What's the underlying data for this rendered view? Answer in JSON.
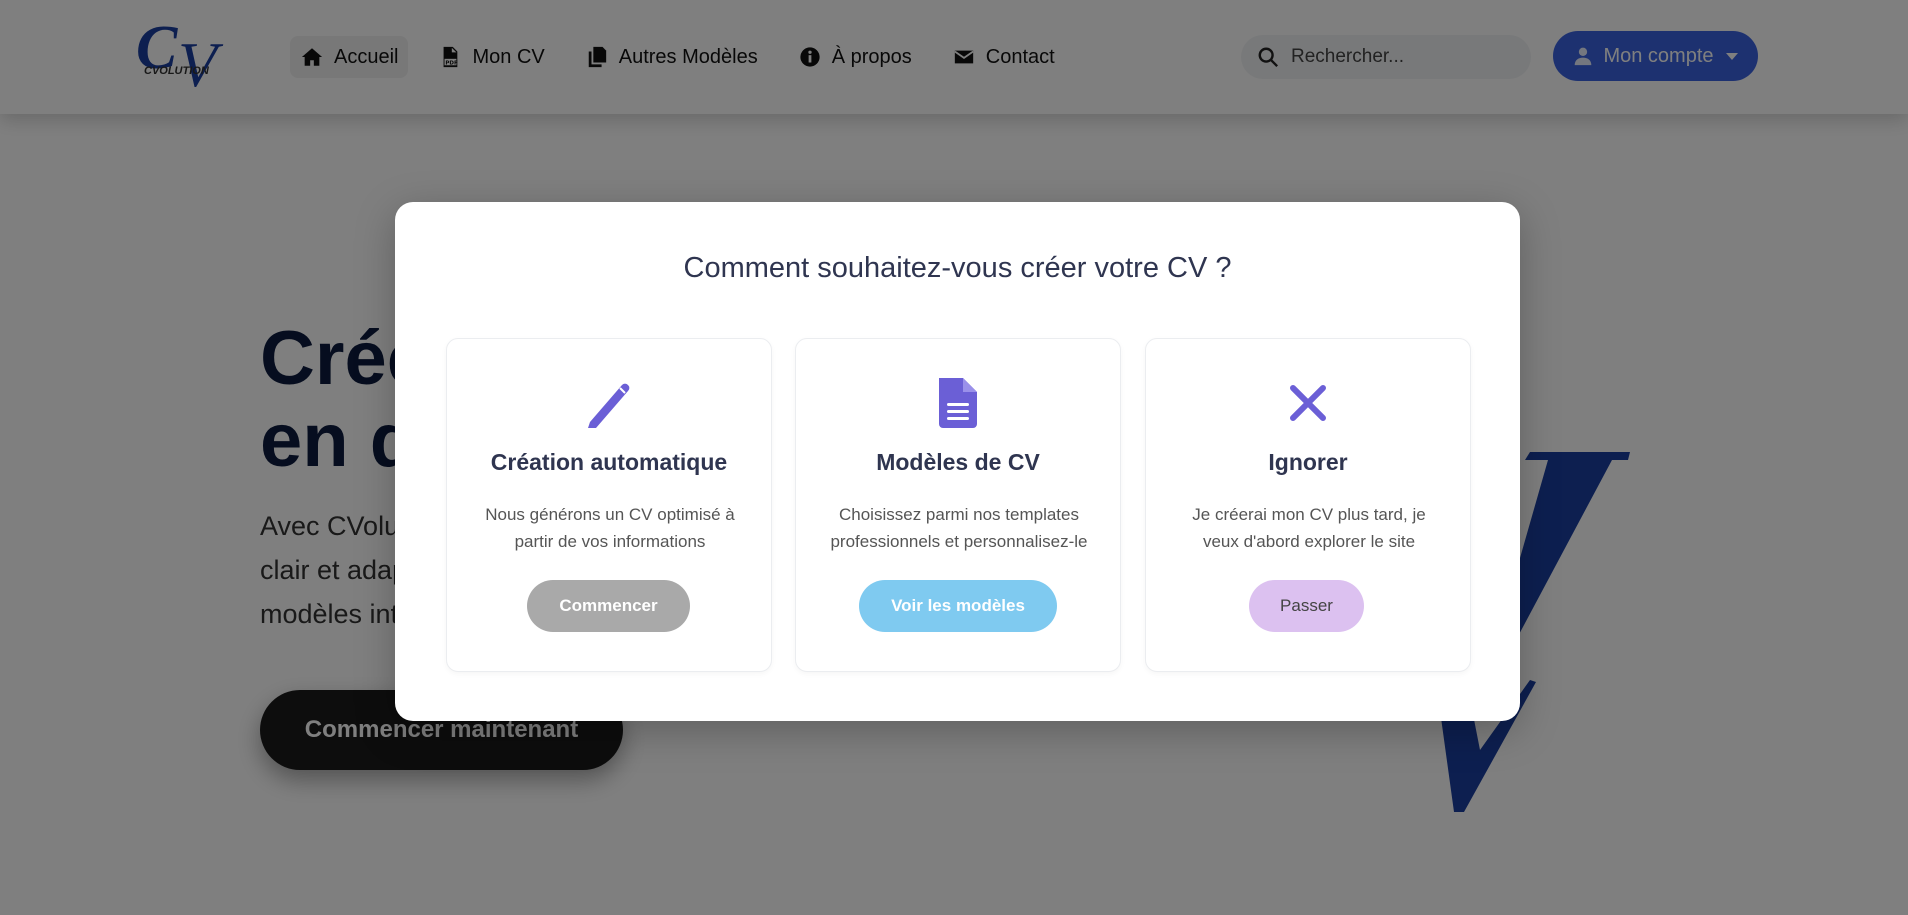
{
  "header": {
    "logo": {
      "alt": "CVolution logo",
      "text_main": "CV",
      "text_sub": "CVOLUTION"
    },
    "nav": [
      {
        "label": "Accueil",
        "icon": "home-icon",
        "active": true
      },
      {
        "label": "Mon CV",
        "icon": "file-pdf-icon",
        "active": false
      },
      {
        "label": "Autres Modèles",
        "icon": "copy-icon",
        "active": false
      },
      {
        "label": "À propos",
        "icon": "info-circle-icon",
        "active": false
      },
      {
        "label": "Contact",
        "icon": "envelope-icon",
        "active": false
      }
    ],
    "search": {
      "placeholder": "Rechercher...",
      "value": ""
    },
    "account": {
      "label": "Mon compte",
      "icon": "user-icon"
    }
  },
  "hero": {
    "title_line1": "Créez votre CV",
    "title_line2": "en quelques clics",
    "text_line1": "Avec CVolution, obtenez un CV",
    "text_line2": "clair et adapté à vos objectifs grâce à nos",
    "text_line3": "modèles intelligents.",
    "cta_label": "Commencer maintenant"
  },
  "modal": {
    "title": "Comment souhaitez-vous créer votre CV ?",
    "options": [
      {
        "title": "Création automatique",
        "description_line1": "Nous générons un CV optimisé à",
        "description_line2": "partir de vos informations",
        "button_label": "Commencer",
        "icon": "pencil-icon"
      },
      {
        "title": "Modèles de CV",
        "description_line1": "Choisissez parmi nos templates",
        "description_line2": "professionnels et personnalisez-le",
        "button_label": "Voir les modèles",
        "icon": "file-document-icon"
      },
      {
        "title": "Ignorer",
        "description_line1": "Je créerai mon CV plus tard, je",
        "description_line2": "veux d'abord explorer le site",
        "button_label": "Passer",
        "icon": "close-icon"
      }
    ]
  },
  "colors": {
    "accent_purple": "#6b5fd6",
    "account_blue": "#3a63e0",
    "btn_commencer": "#a9a9a9",
    "btn_modeles": "#7fcaf0",
    "btn_passer": "#dcc1f0",
    "title_text": "#2f3550",
    "overlay": "rgba(0,0,0,0.5)"
  }
}
